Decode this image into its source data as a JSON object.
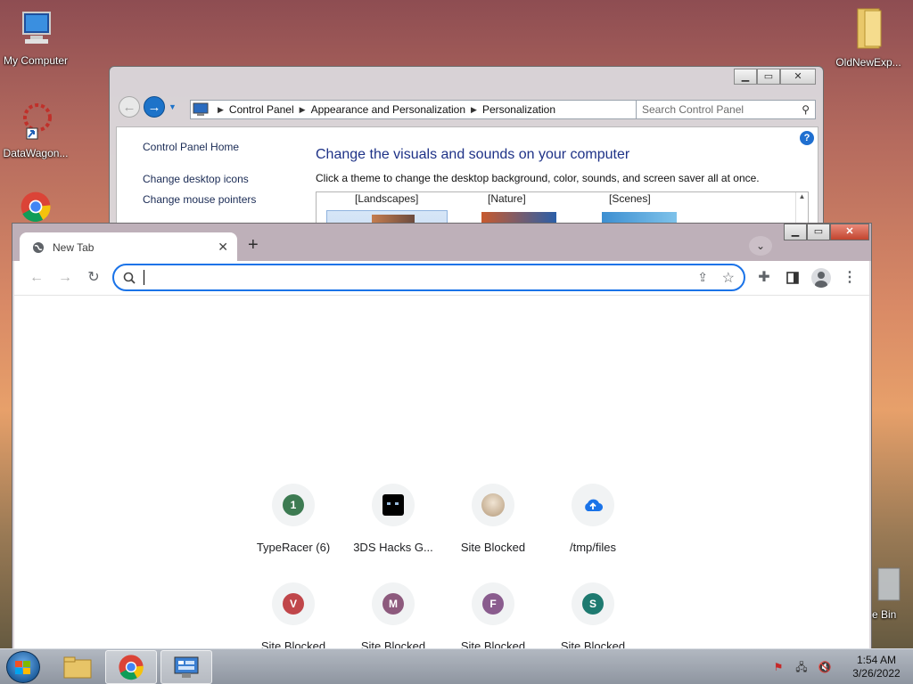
{
  "desktop": {
    "icons": [
      {
        "label": "My Computer"
      },
      {
        "label": "DataWagon..."
      },
      {
        "label": "OldNewExp..."
      },
      {
        "label": "e Bin"
      }
    ]
  },
  "control_panel": {
    "breadcrumb": [
      "Control Panel",
      "Appearance and Personalization",
      "Personalization"
    ],
    "search_placeholder": "Search Control Panel",
    "sidebar_links": [
      "Control Panel Home",
      "Change desktop icons",
      "Change mouse pointers"
    ],
    "heading": "Change the visuals and sounds on your computer",
    "subtext": "Click a theme to change the desktop background, color, sounds, and screen saver all at once.",
    "themes": [
      "[Landscapes]",
      "[Nature]",
      "[Scenes]"
    ]
  },
  "chrome": {
    "tab_title": "New Tab",
    "shortcuts": [
      {
        "title": "TypeRacer (6)",
        "letter": "1",
        "color": "#3d7b52"
      },
      {
        "title": "3DS Hacks G...",
        "letter": "",
        "color": "#000000"
      },
      {
        "title": "Site Blocked",
        "letter": "",
        "color": "#c8b7a0"
      },
      {
        "title": "/tmp/files",
        "letter": "",
        "color": "#1a73e8"
      },
      {
        "title": "Site Blocked",
        "letter": "V",
        "color": "#c0464a"
      },
      {
        "title": "Site Blocked",
        "letter": "M",
        "color": "#8d5a7d"
      },
      {
        "title": "Site Blocked",
        "letter": "F",
        "color": "#8a5c8e"
      },
      {
        "title": "Site Blocked",
        "letter": "S",
        "color": "#1e7a70"
      }
    ]
  },
  "taskbar": {
    "time": "1:54 AM",
    "date": "3/26/2022"
  }
}
